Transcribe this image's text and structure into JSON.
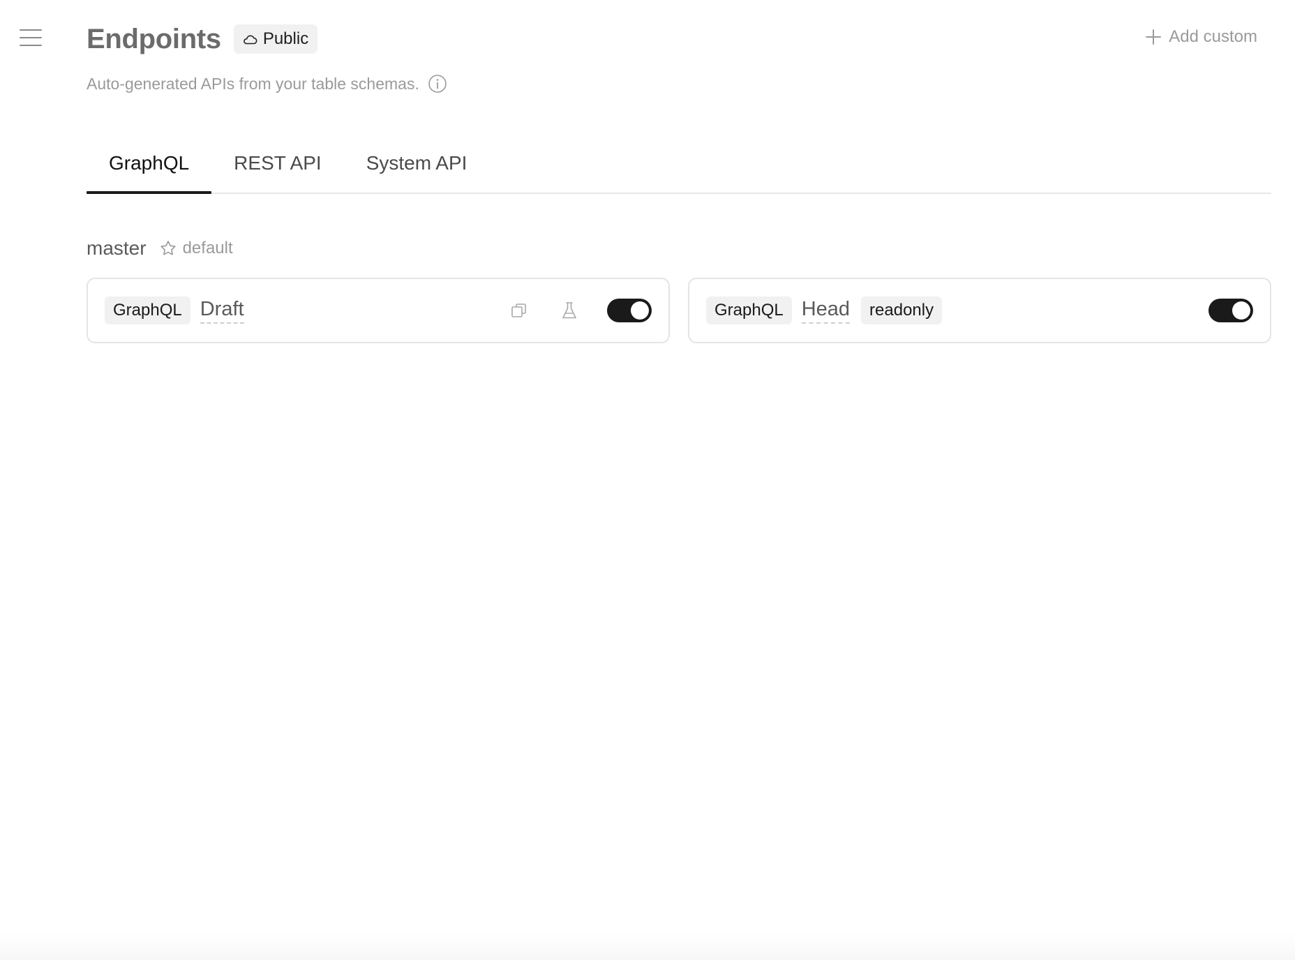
{
  "header": {
    "title": "Endpoints",
    "badge": "Public",
    "add_custom_label": "Add custom",
    "subtitle": "Auto-generated APIs from your table schemas."
  },
  "tabs": [
    {
      "label": "GraphQL",
      "active": true
    },
    {
      "label": "REST API",
      "active": false
    },
    {
      "label": "System API",
      "active": false
    }
  ],
  "branch": {
    "name": "master",
    "default_label": "default"
  },
  "endpoints": [
    {
      "type": "GraphQL",
      "name": "Draft",
      "enabled": true
    },
    {
      "type": "GraphQL",
      "name": "Head",
      "flag": "readonly",
      "enabled": true
    }
  ],
  "icons": {
    "menu": "hamburger-menu-icon",
    "badge": "cloud-icon",
    "add": "plus-icon",
    "info": "info-icon",
    "default": "star-icon",
    "copy": "copy-icon",
    "test": "flask-icon"
  },
  "colors": {
    "toggle_on": "#1a1a1a",
    "tag_bg": "#f1f1f1",
    "muted_text": "#9a9a9a"
  }
}
